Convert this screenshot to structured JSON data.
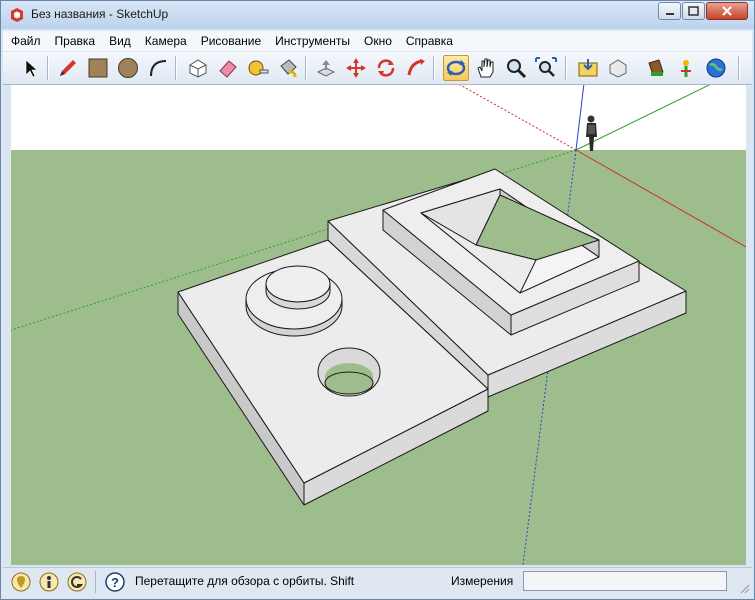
{
  "window": {
    "title": "Без названия - SketchUp"
  },
  "menubar": {
    "items": [
      "Файл",
      "Правка",
      "Вид",
      "Камера",
      "Рисование",
      "Инструменты",
      "Окно",
      "Справка"
    ]
  },
  "toolbar": {
    "tools": [
      "select",
      "pencil",
      "rectangle",
      "circle",
      "arc",
      "make-component",
      "eraser",
      "tape-measure",
      "paint-bucket",
      "push-pull",
      "move",
      "rotate",
      "follow-me",
      "orbit",
      "pan",
      "zoom",
      "zoom-extents",
      "get-models",
      "share-model",
      "share-component",
      "section",
      "google-earth"
    ],
    "active_tool": "orbit"
  },
  "status": {
    "hint": "Перетащите для обзора с орбиты.  Shift",
    "measurements_label": "Измерения",
    "measurements_value": ""
  },
  "colors": {
    "sky": "#ffffff",
    "ground": "#9dbe8c",
    "axis_red": "#d12a2a",
    "axis_green": "#2aa12a",
    "axis_blue": "#2a3fd1",
    "model_face": "#ececec",
    "model_shadow": "#c9c9c9"
  }
}
